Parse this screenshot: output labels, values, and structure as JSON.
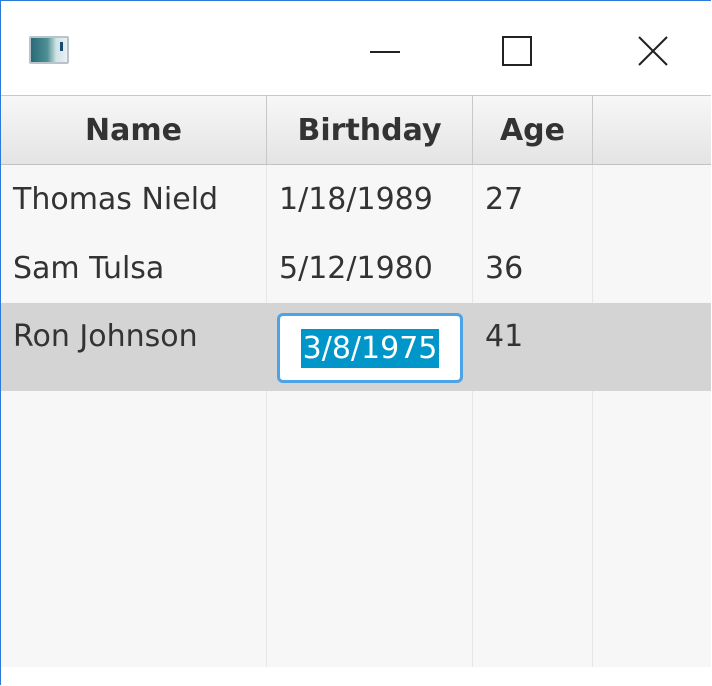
{
  "window": {
    "icon": "app-icon",
    "controls": {
      "minimize": "minimize-icon",
      "maximize": "maximize-icon",
      "close": "close-icon"
    }
  },
  "table": {
    "columns": [
      "Name",
      "Birthday",
      "Age",
      ""
    ],
    "rows": [
      {
        "name": "Thomas Nield",
        "birthday": "1/18/1989",
        "age": "27"
      },
      {
        "name": "Sam Tulsa",
        "birthday": "5/12/1980",
        "age": "36"
      },
      {
        "name": "Ron Johnson",
        "birthday": "3/8/1975",
        "age": "41",
        "selected": true,
        "editing": "birthday"
      }
    ],
    "empty_row_count": 4
  },
  "colors": {
    "window_border": "#2b79d8",
    "selected_row": "#d4d4d4",
    "text_selection": "#0096c9",
    "edit_focus": "#4ea3e6"
  }
}
